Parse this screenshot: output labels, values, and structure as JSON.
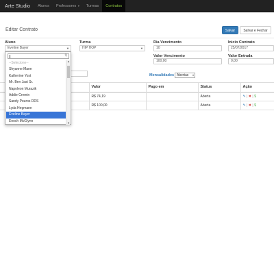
{
  "navbar": {
    "brand": "Arte Studio",
    "items": [
      {
        "label": "Alunos"
      },
      {
        "label": "Professores"
      },
      {
        "label": "Turmas"
      },
      {
        "label": "Contratos"
      }
    ]
  },
  "header": {
    "title": "Editar Contrato",
    "save_label": "Salvar",
    "save_close_label": "Salvar e Fechar"
  },
  "form": {
    "aluno_label": "Aluno",
    "aluno_value": "Eveline Bayer",
    "turma_label": "Turma",
    "turma_value": "HIP HOP",
    "dia_vencimento_label": "Dia Vencimento",
    "dia_vencimento_value": "10",
    "inicio_contrato_label": "Inicio Contrato",
    "inicio_contrato_value": "25/07/2017",
    "valor_vencimento_label": "Valor Vencimento",
    "valor_vencimento_value": "100,00",
    "valor_entrada_label": "Valor Entrada",
    "valor_entrada_value": "0,00"
  },
  "dropdown": {
    "search_value": "",
    "options": [
      {
        "label": "--Selecione--",
        "state": "placeholder"
      },
      {
        "label": "Shyanne Mann",
        "state": "normal"
      },
      {
        "label": "Katherine Yost",
        "state": "normal"
      },
      {
        "label": "Mr. Ben Jast Sr.",
        "state": "normal"
      },
      {
        "label": "Napoleon Murazik",
        "state": "normal"
      },
      {
        "label": "Addie Cremin",
        "state": "normal"
      },
      {
        "label": "Sandy Pouros DDS",
        "state": "normal"
      },
      {
        "label": "Lyda Hegmann",
        "state": "normal"
      },
      {
        "label": "Eveline Bayer",
        "state": "selected"
      },
      {
        "label": "Enoch McGlynn",
        "state": "normal"
      }
    ]
  },
  "mensalidades": {
    "label": "Mensalidades",
    "filter_value": "Abertas"
  },
  "table": {
    "headers": [
      "",
      "Valor",
      "Pago em",
      "Status",
      "Ação"
    ],
    "rows": [
      {
        "venc": "",
        "valor": "R$ 74,19",
        "pago_em": "",
        "status": "Aberta"
      },
      {
        "venc": "",
        "valor": "R$ 100,00",
        "pago_em": "",
        "status": "Aberta"
      }
    ],
    "action_edit_icon": "pencil-icon",
    "action_delete_icon": "x-icon",
    "action_pay_icon": "dollar-icon",
    "action_separator": "|",
    "action_pay_symbol": "$"
  },
  "colors": {
    "navbar_bg": "#222222",
    "active_nav_text": "#8cc63f",
    "primary": "#337ab7",
    "selected_option": "#3875d7",
    "delete": "#d9534f",
    "pay": "#5cb85c"
  }
}
